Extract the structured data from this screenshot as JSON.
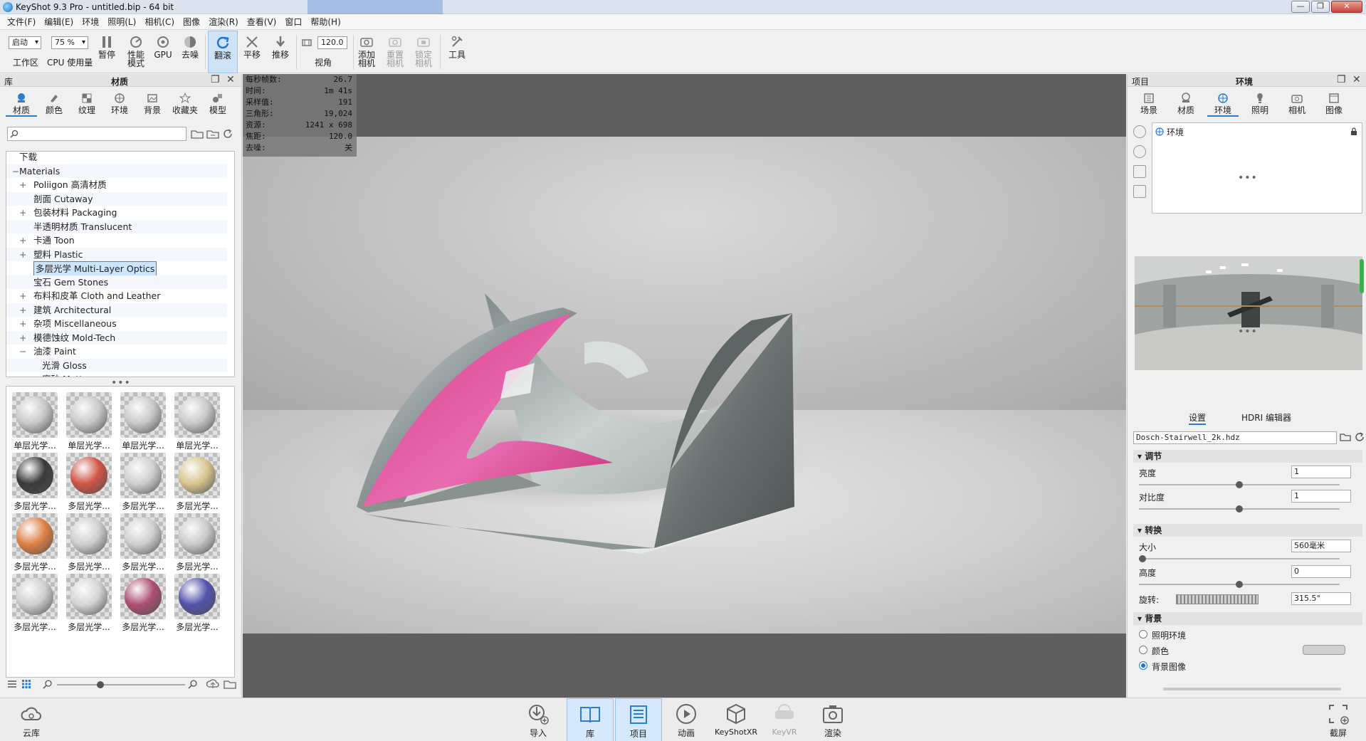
{
  "window": {
    "title": "KeyShot 9.3 Pro  - untitled.bip  - 64 bit",
    "controls": [
      "—",
      "❐",
      "✕"
    ]
  },
  "menu": [
    "文件(F)",
    "编辑(E)",
    "环境",
    "照明(L)",
    "相机(C)",
    "图像",
    "渲染(R)",
    "查看(V)",
    "窗口",
    "帮助(H)"
  ],
  "toolbar": {
    "workspace_select": "启动",
    "workspace_label": "工作区",
    "cpu_select": "75 %",
    "cpu_label": "CPU 使用量",
    "pause": "暂停",
    "perf_mode": "性能\n模式",
    "gpu": "GPU",
    "denoise": "去噪",
    "tumble": "翻滚",
    "pan": "平移",
    "dolly": "推移",
    "fov_value": "120.0",
    "fov_label": "视角",
    "add_camera": "添加\n相机",
    "reset_camera": "重置\n相机",
    "lock_camera": "锁定\n相机",
    "tools": "工具"
  },
  "library": {
    "header_left": "库",
    "header_title": "材质",
    "tabs": [
      "材质",
      "颜色",
      "纹理",
      "环境",
      "背景",
      "收藏夹",
      "模型"
    ],
    "tree": [
      {
        "label": "下载",
        "exp": "",
        "indent": 0
      },
      {
        "label": "Materials",
        "exp": "−",
        "indent": 0
      },
      {
        "label": "Poliigon 高清材质",
        "exp": "+",
        "indent": 1
      },
      {
        "label": "剖面 Cutaway",
        "exp": "",
        "indent": 1
      },
      {
        "label": "包装材料 Packaging",
        "exp": "+",
        "indent": 1
      },
      {
        "label": "半透明材质 Translucent",
        "exp": "",
        "indent": 1
      },
      {
        "label": "卡通 Toon",
        "exp": "+",
        "indent": 1
      },
      {
        "label": "塑料 Plastic",
        "exp": "+",
        "indent": 1
      },
      {
        "label": "多层光学 Multi-Layer Optics",
        "exp": "",
        "indent": 1,
        "selected": true
      },
      {
        "label": "宝石 Gem Stones",
        "exp": "",
        "indent": 1
      },
      {
        "label": "布料和皮革 Cloth and Leather",
        "exp": "+",
        "indent": 1
      },
      {
        "label": "建筑 Architectural",
        "exp": "+",
        "indent": 1
      },
      {
        "label": "杂项 Miscellaneous",
        "exp": "+",
        "indent": 1
      },
      {
        "label": "模德蚀纹 Mold-Tech",
        "exp": "+",
        "indent": 1
      },
      {
        "label": "油漆 Paint",
        "exp": "−",
        "indent": 1
      },
      {
        "label": "光滑 Gloss",
        "exp": "",
        "indent": 2
      },
      {
        "label": "磨砂 Matte",
        "exp": "",
        "indent": 2
      }
    ],
    "materials": [
      {
        "label": "单层光学...",
        "tint": "#c8c8c8"
      },
      {
        "label": "单层光学...",
        "tint": "#c8c8c8"
      },
      {
        "label": "单层光学...",
        "tint": "#c8c8c8"
      },
      {
        "label": "单层光学...",
        "tint": "#c8c8c8"
      },
      {
        "label": "多层光学...",
        "tint": "#2d2d2d"
      },
      {
        "label": "多层光学...",
        "tint": "#d04a3a"
      },
      {
        "label": "多层光学...",
        "tint": "#cfcfcf"
      },
      {
        "label": "多层光学...",
        "tint": "#d9c58a"
      },
      {
        "label": "多层光学...",
        "tint": "#e07a3a"
      },
      {
        "label": "多层光学...",
        "tint": "#cfcfcf"
      },
      {
        "label": "多层光学...",
        "tint": "#cfcfcf"
      },
      {
        "label": "多层光学...",
        "tint": "#c9c9c9"
      },
      {
        "label": "多层光学...",
        "tint": "#cfcfcf"
      },
      {
        "label": "多层光学...",
        "tint": "#d5d5d5"
      },
      {
        "label": "多层光学...",
        "tint": "#a8456a"
      },
      {
        "label": "多层光学...",
        "tint": "#4848a8"
      }
    ]
  },
  "viewport": {
    "stats": [
      {
        "k": "每秒帧数:",
        "v": "26.7"
      },
      {
        "k": "时间:",
        "v": "1m 41s"
      },
      {
        "k": "采样值:",
        "v": "191"
      },
      {
        "k": "三角形:",
        "v": "19,024"
      },
      {
        "k": "资源:",
        "v": "1241 x 698"
      },
      {
        "k": "焦距:",
        "v": "120.0"
      },
      {
        "k": "去噪:",
        "v": "关"
      }
    ]
  },
  "project": {
    "header_left": "项目",
    "header_title": "环境",
    "tabs": [
      "场景",
      "材质",
      "环境",
      "照明",
      "相机",
      "图像"
    ],
    "env_item": "环境",
    "subtabs": [
      "设置",
      "HDRI 编辑器"
    ],
    "hdri_file": "Dosch-Stairwell_2k.hdz",
    "sections": {
      "adjust": "调节",
      "transform": "转换",
      "background": "背景"
    },
    "brightness": {
      "label": "亮度",
      "value": "1",
      "level": 0.5
    },
    "contrast": {
      "label": "对比度",
      "value": "1",
      "level": 0.5
    },
    "size": {
      "label": "大小",
      "value": "560毫米",
      "level": 0.0
    },
    "height": {
      "label": "高度",
      "value": "0",
      "level": 0.5
    },
    "rotation": {
      "label": "旋转:",
      "value": "315.5°"
    },
    "bg_options": [
      {
        "label": "照明环境",
        "checked": false
      },
      {
        "label": "颜色",
        "checked": false
      },
      {
        "label": "背景图像",
        "checked": true
      }
    ]
  },
  "bottom": {
    "cloud": "云库",
    "import": "导入",
    "library": "库",
    "project": "项目",
    "animation": "动画",
    "keyshotxr": "KeyShotXR",
    "keyvr": "KeyVR",
    "render": "渲染",
    "screenshot": "截屏"
  },
  "colors": {
    "accent": "#2b7cd3",
    "selection": "#cde5fb",
    "magenta": "#e0308a"
  }
}
